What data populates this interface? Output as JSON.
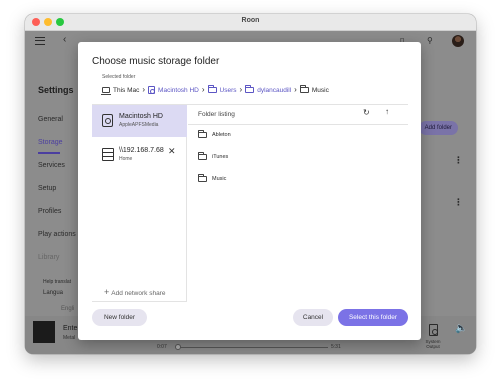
{
  "window": {
    "title": "Roon"
  },
  "app": {
    "settings_title": "Settings",
    "sidebar": [
      {
        "label": "General",
        "state": "normal"
      },
      {
        "label": "Storage",
        "state": "active"
      },
      {
        "label": "Services",
        "state": "normal"
      },
      {
        "label": "Setup",
        "state": "normal"
      },
      {
        "label": "Profiles",
        "state": "normal"
      },
      {
        "label": "Play actions",
        "state": "normal"
      },
      {
        "label": "Library",
        "state": "faint"
      }
    ],
    "help_text": "Help translat",
    "language_label": "Langua",
    "language_value": "Engli",
    "add_folder_label": "Add folder",
    "now_playing": {
      "title": "Ente",
      "artist": "Metal",
      "time_elapsed": "0:07",
      "time_total": "5:31",
      "output_label": "System Output"
    }
  },
  "dialog": {
    "title": "Choose music storage folder",
    "selected_folder_label": "Selected folder",
    "breadcrumb": [
      {
        "label": "This Mac",
        "icon": "computer-icon",
        "link": false
      },
      {
        "label": "Macintosh HD",
        "icon": "disk-icon",
        "link": true
      },
      {
        "label": "Users",
        "icon": "folder-icon",
        "link": true
      },
      {
        "label": "dylancaudill",
        "icon": "folder-icon",
        "link": true
      },
      {
        "label": "Music",
        "icon": "folder-icon",
        "link": false
      }
    ],
    "locations": [
      {
        "name": "Macintosh HD",
        "sub": "AppleAPFSMedia",
        "icon": "disk-icon",
        "selected": true
      },
      {
        "name": "\\\\192.168.7.68",
        "sub": "Home",
        "icon": "server-icon",
        "selected": false
      }
    ],
    "add_network_share": "Add network share",
    "listing_header": "Folder listing",
    "folders": [
      "Ableton",
      "iTunes",
      "Music"
    ],
    "buttons": {
      "new_folder": "New folder",
      "cancel": "Cancel",
      "select": "Select this folder"
    }
  },
  "colors": {
    "accent": "#7b72e6",
    "link": "#5c56c4",
    "selected_row": "#dcdaf3"
  }
}
